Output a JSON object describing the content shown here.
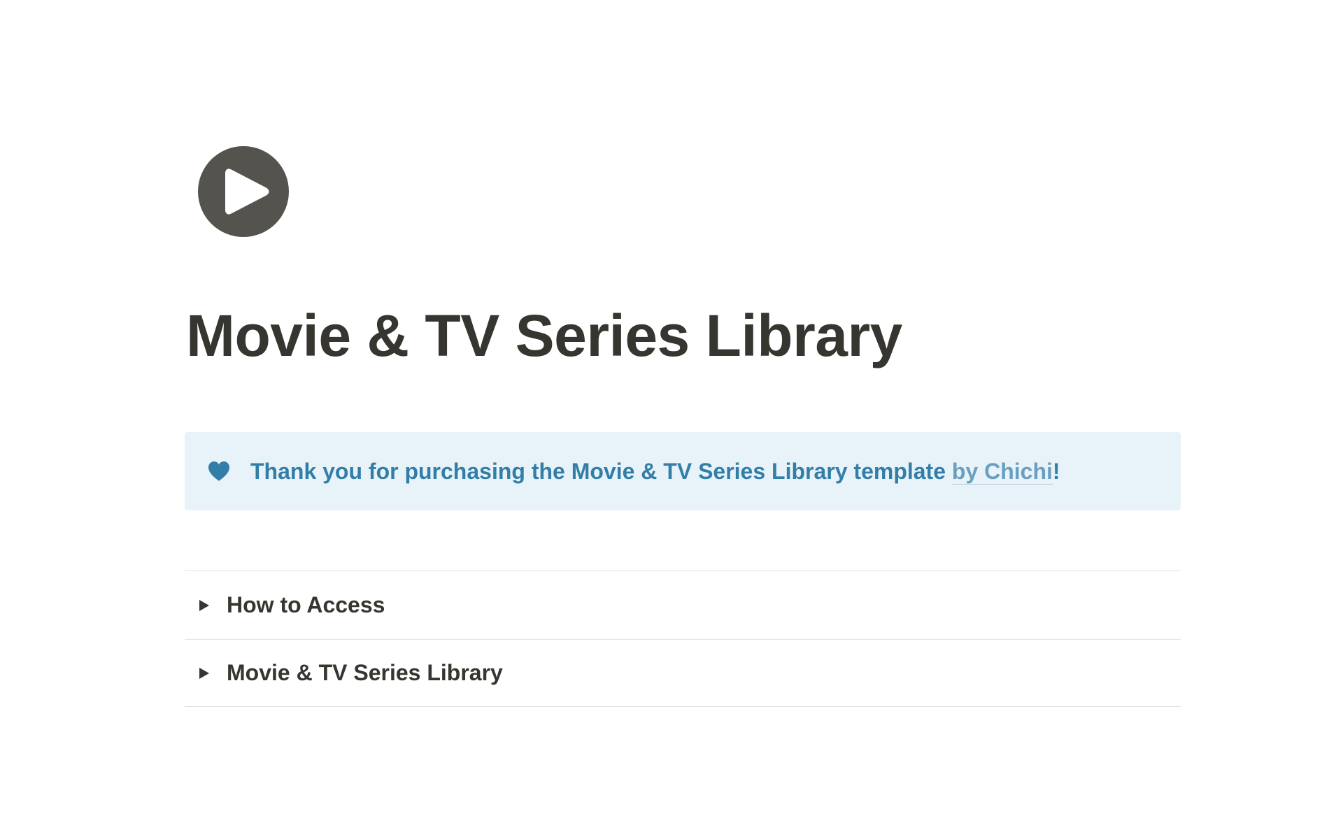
{
  "page": {
    "icon": "play-circle-icon",
    "title": "Movie & TV Series Library"
  },
  "callout": {
    "icon": "heart-icon",
    "text_before": "Thank you for purchasing the Movie & TV Series Library template ",
    "link_text": "by Chichi",
    "text_after": "!",
    "background_color": "#e7f3f8",
    "text_color": "#337ea9"
  },
  "toggles": [
    {
      "label": "How to Access",
      "icon": "triangle-right-icon"
    },
    {
      "label": "Movie & TV Series Library",
      "icon": "triangle-right-icon"
    }
  ],
  "colors": {
    "text": "#37352f",
    "icon_fill": "#55534e",
    "divider": "#e3e2e0"
  }
}
